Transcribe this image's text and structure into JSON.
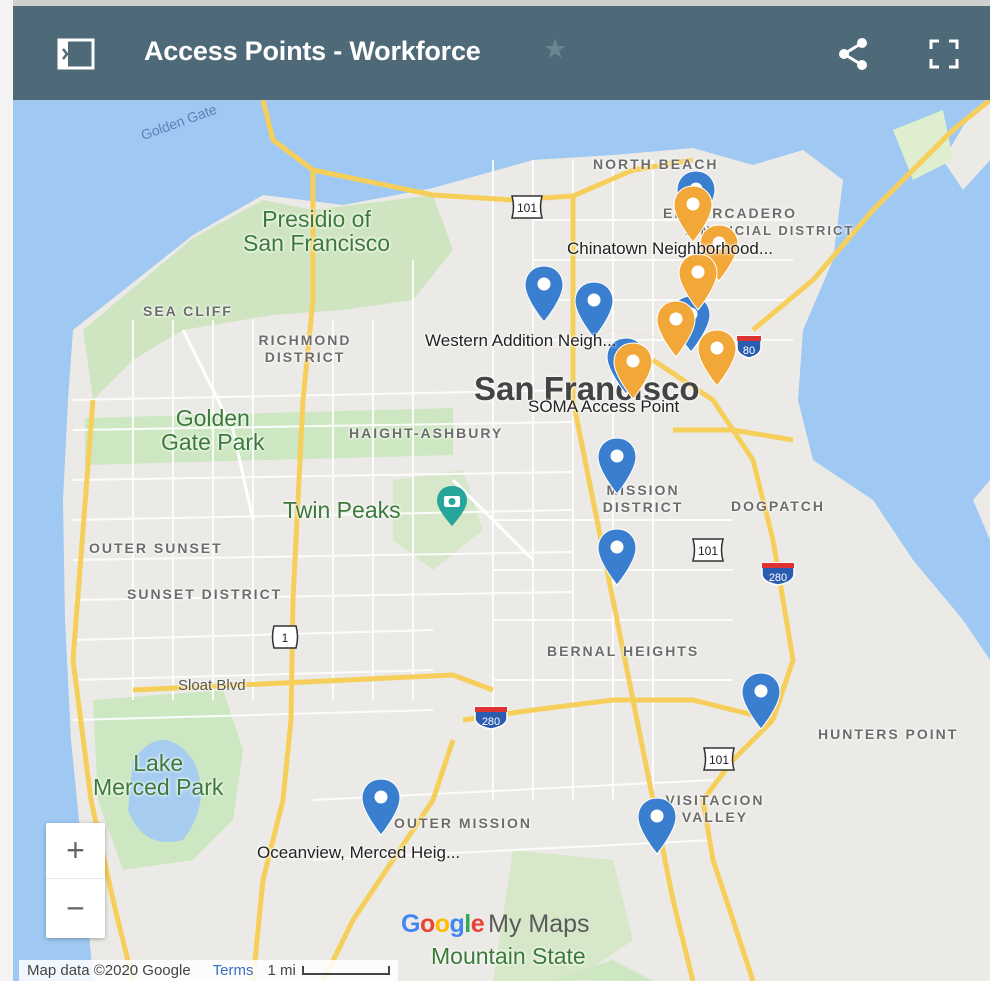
{
  "header": {
    "title": "Access Points - Workforce",
    "icons": {
      "sidebar": "sidebar-toggle-icon",
      "star": "star-icon",
      "share": "share-icon",
      "fullscreen": "fullscreen-icon"
    },
    "background": "#4e6a78"
  },
  "map": {
    "city_label": "San Francisco",
    "water_label": "Golden Gate",
    "green_areas": [
      {
        "name": "presidio",
        "lines": [
          "Presidio of",
          "San Francisco"
        ]
      },
      {
        "name": "golden-gate-park",
        "lines": [
          "Golden",
          "Gate Park"
        ]
      },
      {
        "name": "lake-merced-park",
        "lines": [
          "Lake",
          "Merced Park"
        ]
      },
      {
        "name": "mountain-state",
        "lines": [
          "Mountain State"
        ]
      }
    ],
    "poi": {
      "name": "Twin Peaks",
      "icon": "camera-icon"
    },
    "neighborhoods": [
      "NORTH BEACH",
      "EMBARCADERO",
      "FINANCIAL DISTRICT",
      "SEA CLIFF",
      "RICHMOND DISTRICT",
      "HAIGHT-ASHBURY",
      "MISSION DISTRICT",
      "DOGPATCH",
      "OUTER SUNSET",
      "SUNSET DISTRICT",
      "BERNAL HEIGHTS",
      "HUNTERS POINT",
      "OUTER MISSION",
      "VISITACION VALLEY"
    ],
    "street_label": "Sloat Blvd",
    "highway_shields": [
      {
        "route": "101",
        "type": "us"
      },
      {
        "route": "101",
        "type": "us"
      },
      {
        "route": "101",
        "type": "us"
      },
      {
        "route": "1",
        "type": "state"
      },
      {
        "route": "80",
        "type": "interstate"
      },
      {
        "route": "280",
        "type": "interstate"
      },
      {
        "route": "280",
        "type": "interstate"
      }
    ],
    "pins": [
      {
        "name": "Chinatown Neighborhood...",
        "color": "#f2a838",
        "labeled": true
      },
      {
        "name": "Western Addition Neigh...",
        "color": "#3a7fcf",
        "labeled": true
      },
      {
        "name": "SOMA Access Point",
        "color": "#f2a838",
        "labeled": true
      },
      {
        "name": "Oceanview, Merced Heig...",
        "color": "#3a7fcf",
        "labeled": true
      }
    ],
    "pin_colors": {
      "blue": "#3a7fcf",
      "orange": "#f2a838"
    },
    "zoom": {
      "in": "+",
      "out": "−"
    },
    "branding": {
      "google": [
        "G",
        "o",
        "o",
        "g",
        "l",
        "e"
      ],
      "product": "My Maps"
    },
    "footer": {
      "attribution": "Map data ©2020 Google",
      "terms": "Terms",
      "scale": "1 mi"
    }
  }
}
